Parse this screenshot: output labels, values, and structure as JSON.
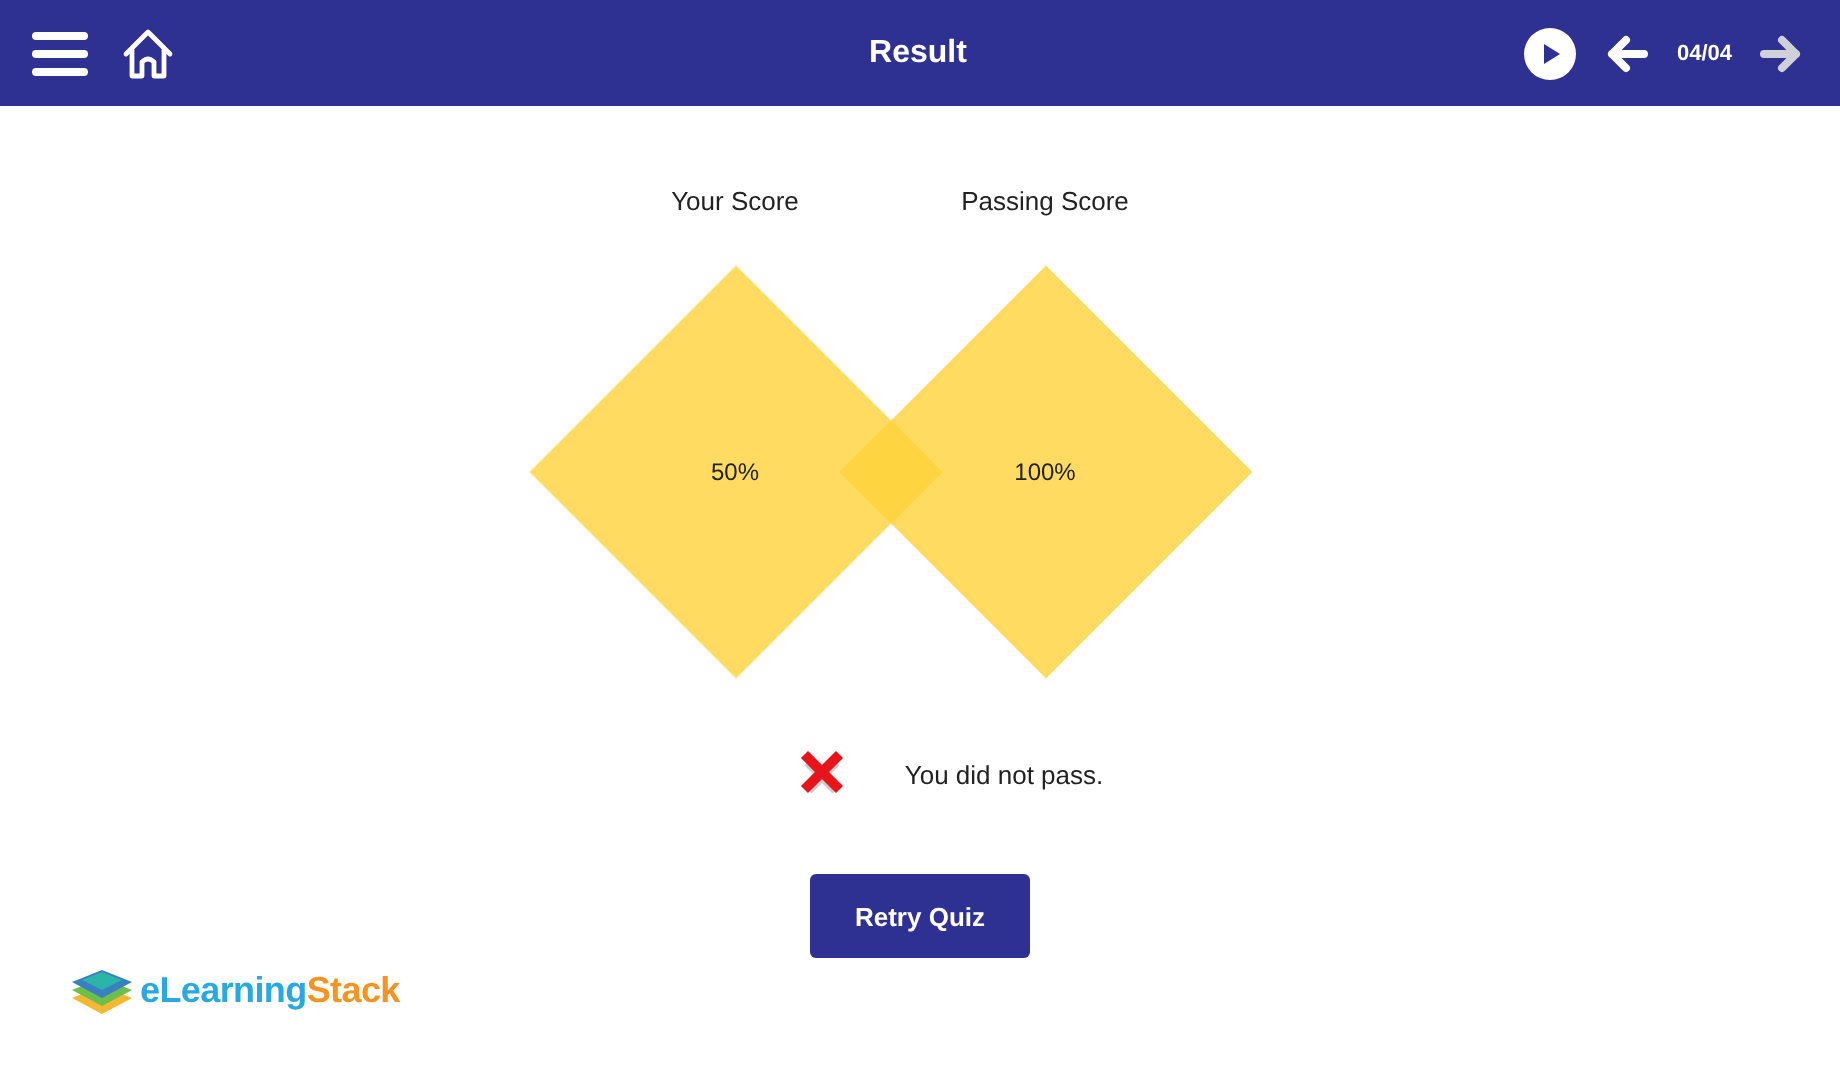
{
  "header": {
    "title": "Result",
    "page_counter": "04/04",
    "prev_disabled": false,
    "next_disabled": true
  },
  "scores": [
    {
      "label": "Your Score",
      "value": "50%"
    },
    {
      "label": "Passing Score",
      "value": "100%"
    }
  ],
  "result": {
    "passed": false,
    "message": "You did not pass."
  },
  "retry_button": "Retry Quiz",
  "logo": {
    "words": [
      {
        "text": "eLearning",
        "color": "#29a9e1"
      },
      {
        "text": "Stack",
        "color": "#f7931e"
      }
    ]
  }
}
